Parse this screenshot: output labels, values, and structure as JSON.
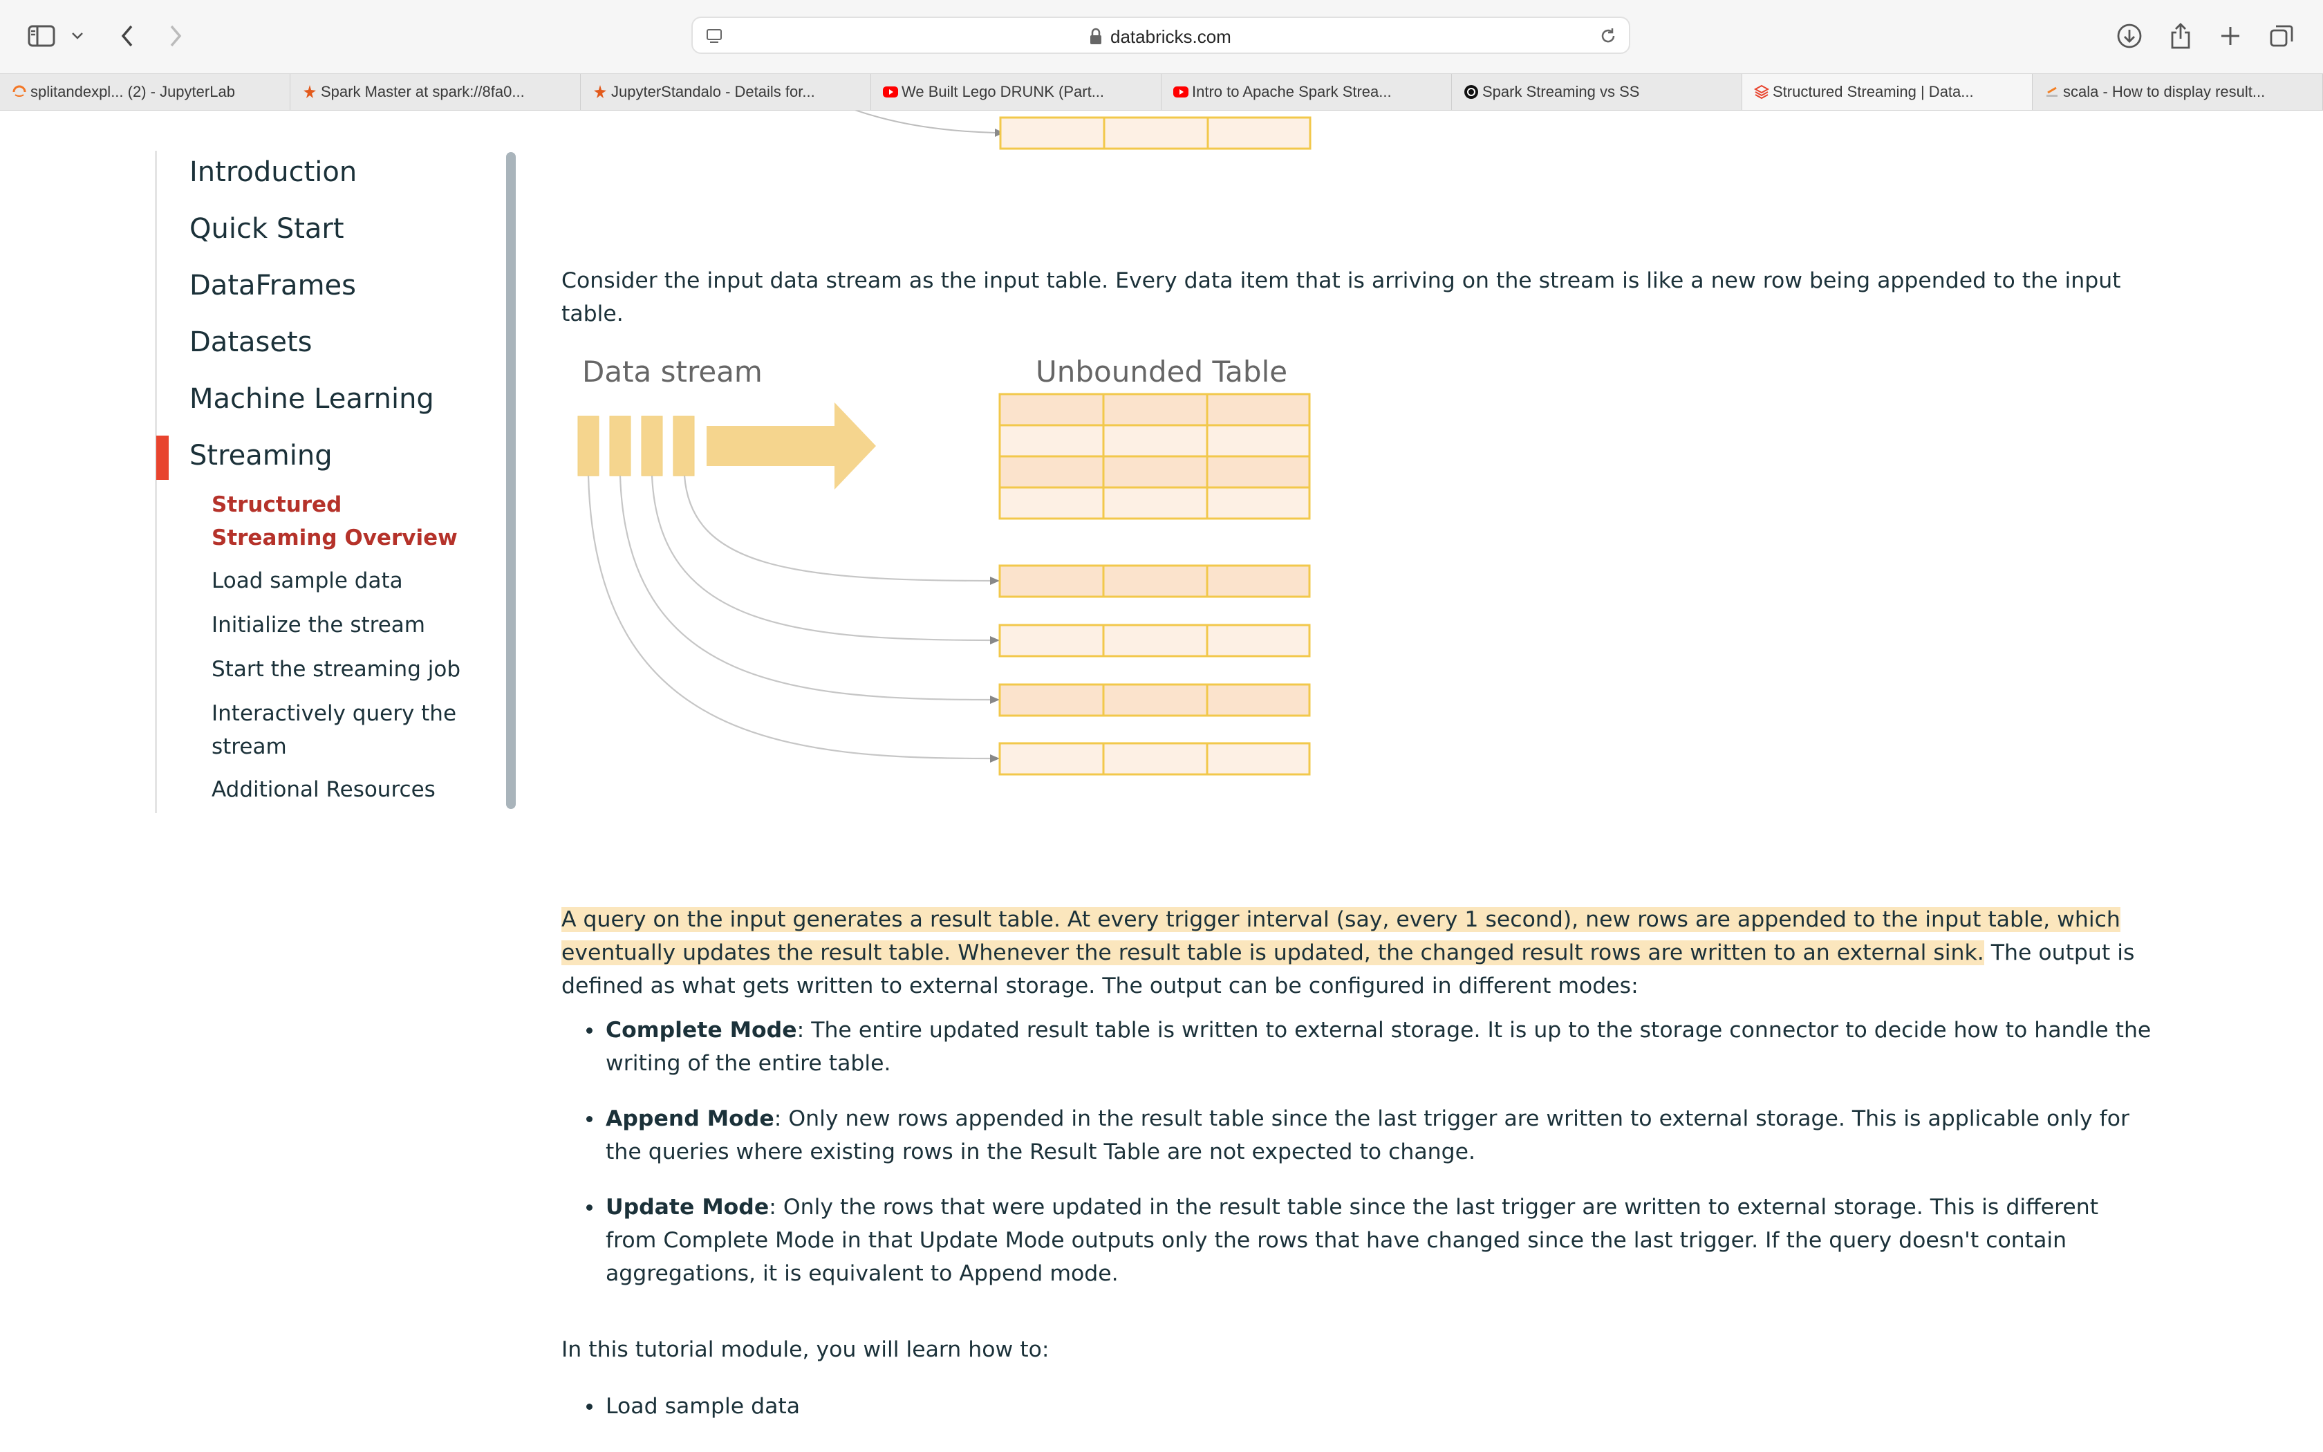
{
  "browser": {
    "url": "databricks.com",
    "tabs": [
      {
        "title": "splitandexpl... (2) - JupyterLab",
        "favicon": "jupyter-icon",
        "color": "#f37726"
      },
      {
        "title": "Spark Master at spark://8fa0...",
        "favicon": "spark-icon",
        "color": "#e25a1c"
      },
      {
        "title": "JupyterStandalo - Details for...",
        "favicon": "spark-icon",
        "color": "#e25a1c"
      },
      {
        "title": "We Built Lego DRUNK (Part...",
        "favicon": "youtube-icon",
        "color": "#ff0000"
      },
      {
        "title": "Intro to Apache Spark Strea...",
        "favicon": "youtube-icon",
        "color": "#ff0000"
      },
      {
        "title": "Spark Streaming vs SS",
        "favicon": "openai-icon",
        "color": "#111111"
      },
      {
        "title": "Structured Streaming | Data...",
        "favicon": "databricks-icon",
        "color": "#e8442e"
      },
      {
        "title": "scala - How to display result...",
        "favicon": "stackoverflow-icon",
        "color": "#f48024"
      }
    ],
    "active_tab": 6
  },
  "sidebar": {
    "items": [
      {
        "label": "Introduction"
      },
      {
        "label": "Quick Start"
      },
      {
        "label": "DataFrames"
      },
      {
        "label": "Datasets"
      },
      {
        "label": "Machine Learning"
      },
      {
        "label": "Streaming"
      }
    ],
    "active_item": "Streaming",
    "subitems": [
      {
        "label": "Structured Streaming Overview"
      },
      {
        "label": "Load sample data"
      },
      {
        "label": "Initialize the stream"
      },
      {
        "label": "Start the streaming job"
      },
      {
        "label": "Interactively query the stream"
      },
      {
        "label": "Additional Resources"
      }
    ],
    "active_subitem": "Structured Streaming Overview",
    "accent_color": "#e8442e"
  },
  "content": {
    "intro_paragraph": "Consider the input data stream as the input table. Every data item that is arriving on the stream is like a new row being appended to the input table.",
    "diagram": {
      "stream_label": "Data stream",
      "table_label": "Unbounded Table",
      "fill_dark": "#fbe3cc",
      "fill_light": "#fdf0e4",
      "border": "#f2c84b",
      "arrow_fill": "#f5d58e"
    },
    "result_paragraph_highlight": "A query on the input generates a result table. At every trigger interval (say, every 1 second), new rows are appended to the input table, which eventually updates the result table. Whenever the result table is updated, the changed result rows are written to an external sink.",
    "result_paragraph_rest": " The output is defined as what gets written to external storage. The output can be configured in different modes:",
    "modes": [
      {
        "name": "Complete Mode",
        "text": ": The entire updated result table is written to external storage. It is up to the storage connector to decide how to handle the writing of the entire table."
      },
      {
        "name": "Append Mode",
        "text": ": Only new rows appended in the result table since the last trigger are written to external storage. This is applicable only for the queries where existing rows in the Result Table are not expected to change."
      },
      {
        "name": "Update Mode",
        "text": ": Only the rows that were updated in the result table since the last trigger are written to external storage. This is different from Complete Mode in that Update Mode outputs only the rows that have changed since the last trigger. If the query doesn't contain aggregations, it is equivalent to Append mode."
      }
    ],
    "learn_intro": "In this tutorial module, you will learn how to:",
    "learn_items": [
      "Load sample data"
    ]
  }
}
